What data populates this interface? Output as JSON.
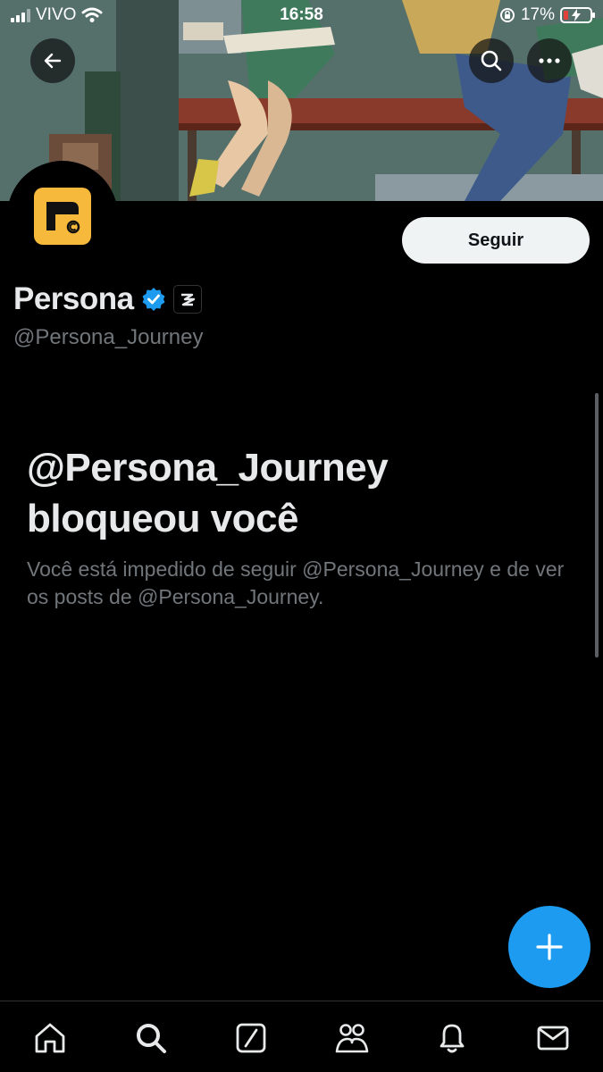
{
  "status_bar": {
    "carrier": "VIVO",
    "time": "16:58",
    "battery": "17%"
  },
  "profile": {
    "display_name": "Persona",
    "handle": "@Persona_Journey",
    "follow_label": "Seguir"
  },
  "blocked": {
    "title_line1": "@Persona_Journey",
    "title_line2": "bloqueou você",
    "description": "Você está impedido de seguir @Persona_Journey e de ver os posts de @Persona_Journey."
  },
  "colors": {
    "accent": "#1d9bf0",
    "verified": "#1d9bf0",
    "logo": "#f6b93b",
    "muted_text": "#71767b"
  },
  "icons": {
    "header": [
      "back-arrow-icon",
      "search-icon",
      "more-icon"
    ],
    "tabs": [
      "home-icon",
      "search-icon",
      "grok-icon",
      "communities-icon",
      "notifications-icon",
      "messages-icon"
    ],
    "fab": "plus-icon"
  }
}
